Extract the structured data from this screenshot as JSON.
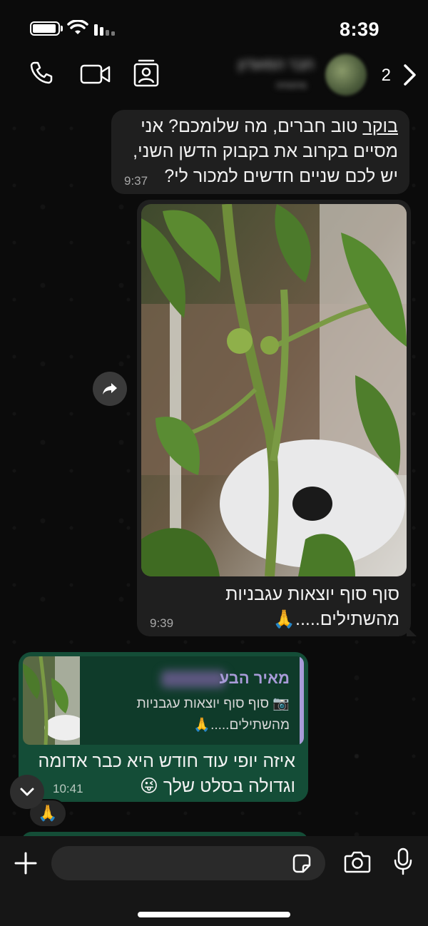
{
  "status_bar": {
    "time": "8:39"
  },
  "header": {
    "contact_name": "חבר המועדון",
    "contact_subtitle": "מתמחה",
    "back_count": "2"
  },
  "messages": [
    {
      "direction": "incoming",
      "text_underlined": "בוקר",
      "text": " טוב חברים, מה שלומכם? אני מסיים בקרוב את בקבוק הדשן השני, יש לכם שניים חדשים למכור לי?",
      "time": "9:37"
    },
    {
      "direction": "incoming",
      "type": "image",
      "image_description_icon": "tomato-plant-photo",
      "caption": "סוף סוף יוצאות עגבניות מהשתילים.....🙏",
      "time": "9:39"
    },
    {
      "direction": "outgoing",
      "quote": {
        "author": "מאיר הבע",
        "camera_icon": "📷",
        "text": "סוף סוף יוצאות עגבניות מהשתילים.....🙏"
      },
      "text": "איזה יופי עוד חודש היא כבר אדומה וגדולה בסלט שלך 😜",
      "time": "10:41"
    }
  ],
  "reaction": "🙏",
  "colors": {
    "incoming_bubble": "#1f1f1f",
    "outgoing_bubble": "#144d37",
    "quote_accent": "#a89bd8"
  }
}
